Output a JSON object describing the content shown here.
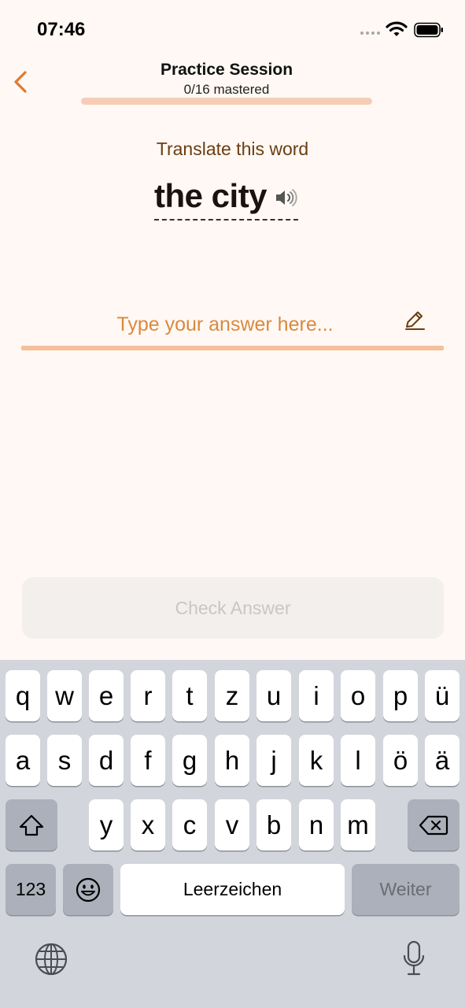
{
  "status": {
    "time": "07:46"
  },
  "header": {
    "title": "Practice Session",
    "subtitle": "0/16 mastered",
    "progress_fraction": 0
  },
  "prompt": {
    "label": "Translate this word",
    "word": "the city"
  },
  "answer": {
    "placeholder": "Type your answer here...",
    "value": ""
  },
  "check_button": {
    "label": "Check Answer"
  },
  "keyboard": {
    "row1": [
      "q",
      "w",
      "e",
      "r",
      "t",
      "z",
      "u",
      "i",
      "o",
      "p",
      "ü"
    ],
    "row2": [
      "a",
      "s",
      "d",
      "f",
      "g",
      "h",
      "j",
      "k",
      "l",
      "ö",
      "ä"
    ],
    "row3": [
      "y",
      "x",
      "c",
      "v",
      "b",
      "n",
      "m"
    ],
    "numbers_label": "123",
    "space_label": "Leerzeichen",
    "return_label": "Weiter"
  },
  "colors": {
    "accent": "#e88a4c",
    "background": "#fff8f4",
    "prompt_text": "#6b3d12"
  },
  "icons": [
    "back-chevron-icon",
    "wifi-icon",
    "battery-icon",
    "speaker-icon",
    "pencil-icon",
    "shift-icon",
    "backspace-icon",
    "emoji-icon",
    "globe-icon",
    "microphone-icon"
  ]
}
